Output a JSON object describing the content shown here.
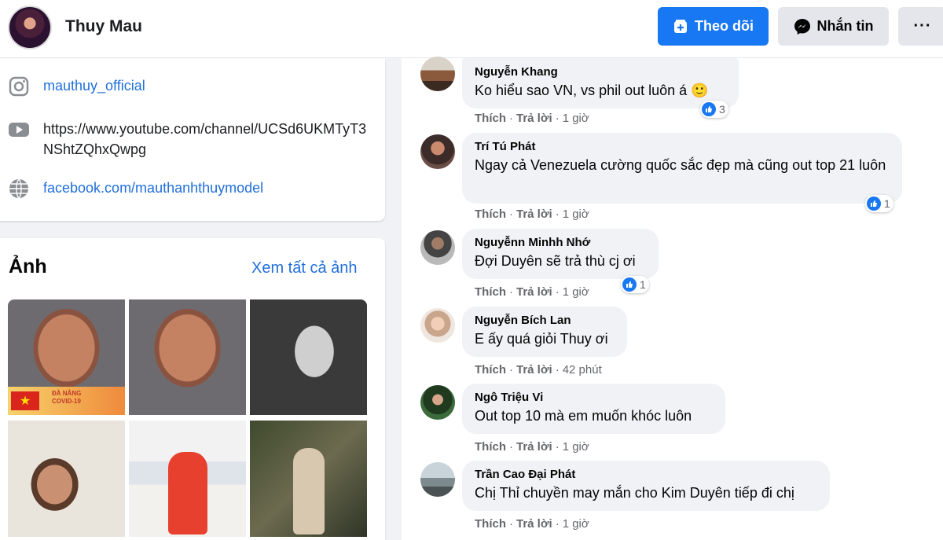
{
  "header": {
    "name": "Thuy Mau",
    "follow_label": "Theo dõi",
    "message_label": "Nhắn tin",
    "more_label": "···"
  },
  "intro": {
    "instagram": "mauthuy_official",
    "youtube": "https://www.youtube.com/channel/UCSd6UKMTyT3NShtZQhxQwpg",
    "website": "facebook.com/mauthanhthuymodel"
  },
  "photos": {
    "title": "Ảnh",
    "see_all": "Xem tất cả ảnh",
    "banner_text": "ĐÀ NẴNG\nCOVID-19"
  },
  "comments": [
    {
      "name": "Nguyễn Khang",
      "text": "Ko hiểu sao VN, vs phil out luôn á 🙂",
      "like_label": "Thích",
      "reply_label": "Trả lời",
      "time": "1 giờ",
      "reactions": "3"
    },
    {
      "name": "Trí Tú Phát",
      "text": "Ngay cả Venezuela cường quốc sắc đẹp mà cũng out top 21 luôn",
      "like_label": "Thích",
      "reply_label": "Trả lời",
      "time": "1 giờ",
      "reactions": "1"
    },
    {
      "name": "Nguyễnn Minhh Nhớ",
      "text": "Đợi Duyên sẽ trả thù cj ơi",
      "like_label": "Thích",
      "reply_label": "Trả lời",
      "time": "1 giờ",
      "reactions": "1"
    },
    {
      "name": "Nguyễn Bích Lan",
      "text": "E ấy quá giỏi Thuy ơi",
      "like_label": "Thích",
      "reply_label": "Trả lời",
      "time": "42 phút",
      "reactions": ""
    },
    {
      "name": "Ngô Triệu Vi",
      "text": "Out top 10 mà em muốn khóc luôn",
      "like_label": "Thích",
      "reply_label": "Trả lời",
      "time": "1 giờ",
      "reactions": ""
    },
    {
      "name": "Trần Cao Đại Phát",
      "text": "Chị Thỉ chuyền may mắn cho Kim Duyên tiếp đi chị",
      "like_label": "Thích",
      "reply_label": "Trả lời",
      "time": "1 giờ",
      "reactions": ""
    }
  ],
  "colors": {
    "accent": "#1877f2",
    "link": "#216fdb",
    "muted": "#65676b",
    "bubble": "#f0f2f5"
  }
}
